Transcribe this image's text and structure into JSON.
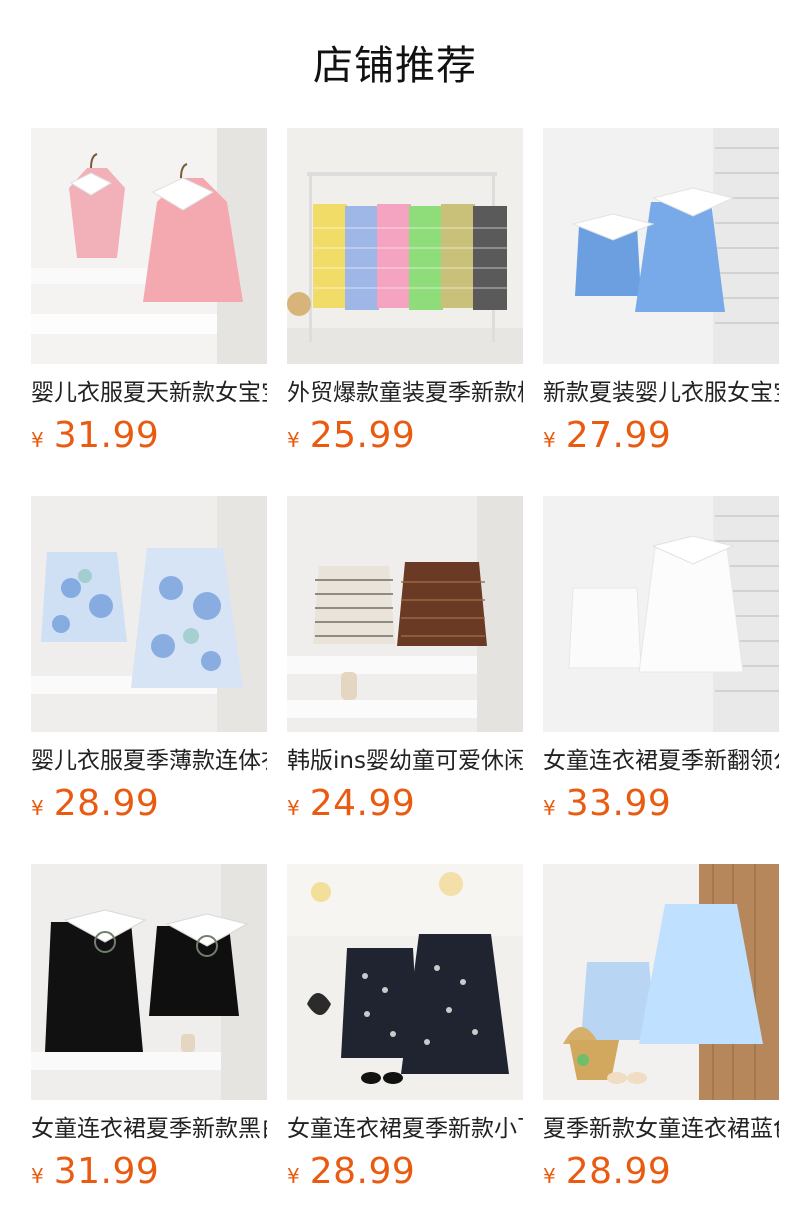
{
  "section": {
    "title": "店铺推荐"
  },
  "products": [
    {
      "name": "婴儿衣服夏天新款女宝宝",
      "currency": "¥",
      "price": "31.99"
    },
    {
      "name": "外贸爆款童装夏季新款格",
      "currency": "¥",
      "price": "25.99"
    },
    {
      "name": "新款夏装婴儿衣服女宝宝",
      "currency": "¥",
      "price": "27.99"
    },
    {
      "name": "婴儿衣服夏季薄款连体衣",
      "currency": "¥",
      "price": "28.99"
    },
    {
      "name": "韩版ins婴幼童可爱休闲",
      "currency": "¥",
      "price": "24.99"
    },
    {
      "name": "女童连衣裙夏季新翻领公",
      "currency": "¥",
      "price": "33.99"
    },
    {
      "name": "女童连衣裙夏季新款黑白",
      "currency": "¥",
      "price": "31.99"
    },
    {
      "name": "女童连衣裙夏季新款小飞",
      "currency": "¥",
      "price": "28.99"
    },
    {
      "name": "夏季新款女童连衣裙蓝色",
      "currency": "¥",
      "price": "28.99"
    }
  ]
}
